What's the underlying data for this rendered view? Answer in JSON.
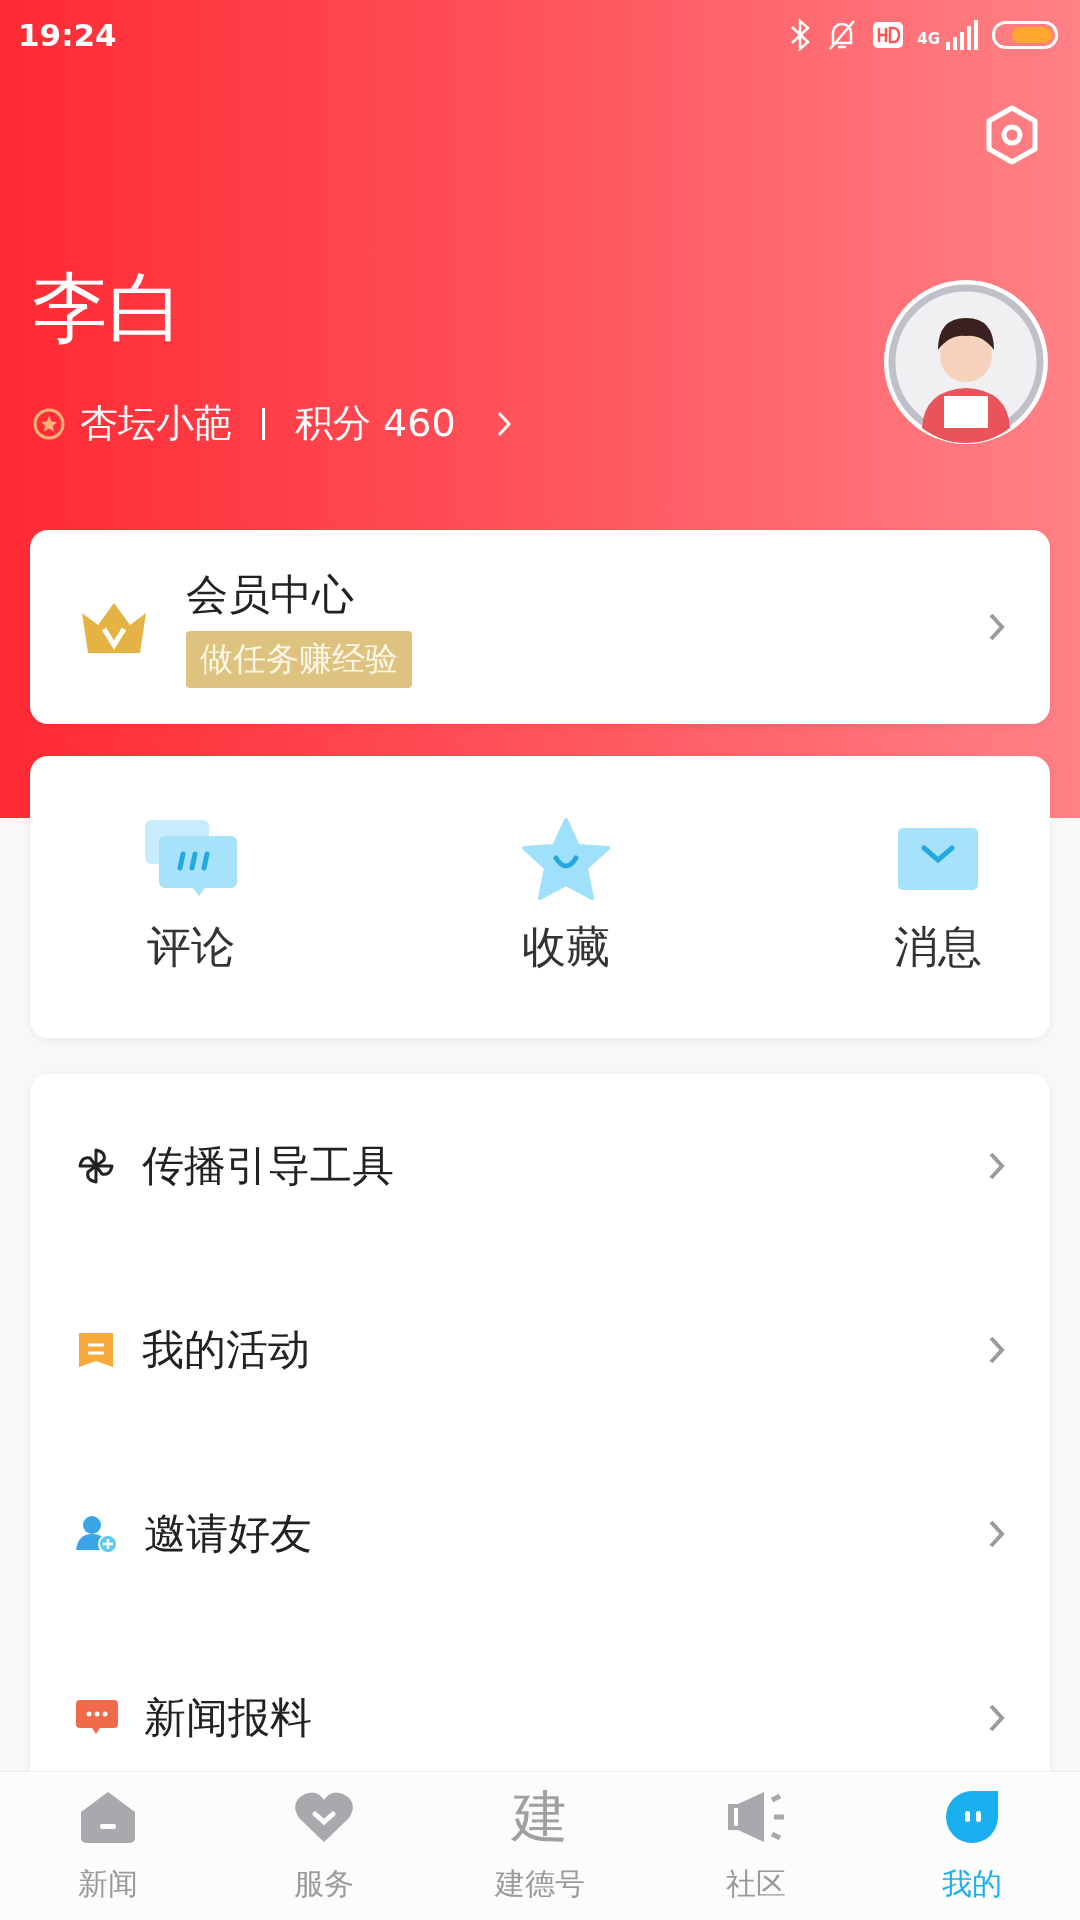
{
  "status_bar": {
    "time": "19:24",
    "network": "4G"
  },
  "profile": {
    "name": "李白",
    "title": "杏坛小葩",
    "points": "积分 460"
  },
  "member": {
    "title": "会员中心",
    "tag": "做任务赚经验"
  },
  "actions": [
    {
      "label": "评论"
    },
    {
      "label": "收藏"
    },
    {
      "label": "消息"
    }
  ],
  "menu": [
    {
      "label": "传播引导工具"
    },
    {
      "label": "我的活动"
    },
    {
      "label": "邀请好友"
    },
    {
      "label": "新闻报料"
    }
  ],
  "tabs": [
    {
      "label": "新闻",
      "selected": false,
      "kind": "home"
    },
    {
      "label": "服务",
      "selected": false,
      "kind": "heart"
    },
    {
      "label": "建德号",
      "selected": false,
      "kind": "logo",
      "logo_text": "建"
    },
    {
      "label": "社区",
      "selected": false,
      "kind": "speaker"
    },
    {
      "label": "我的",
      "selected": true,
      "kind": "mine"
    }
  ]
}
